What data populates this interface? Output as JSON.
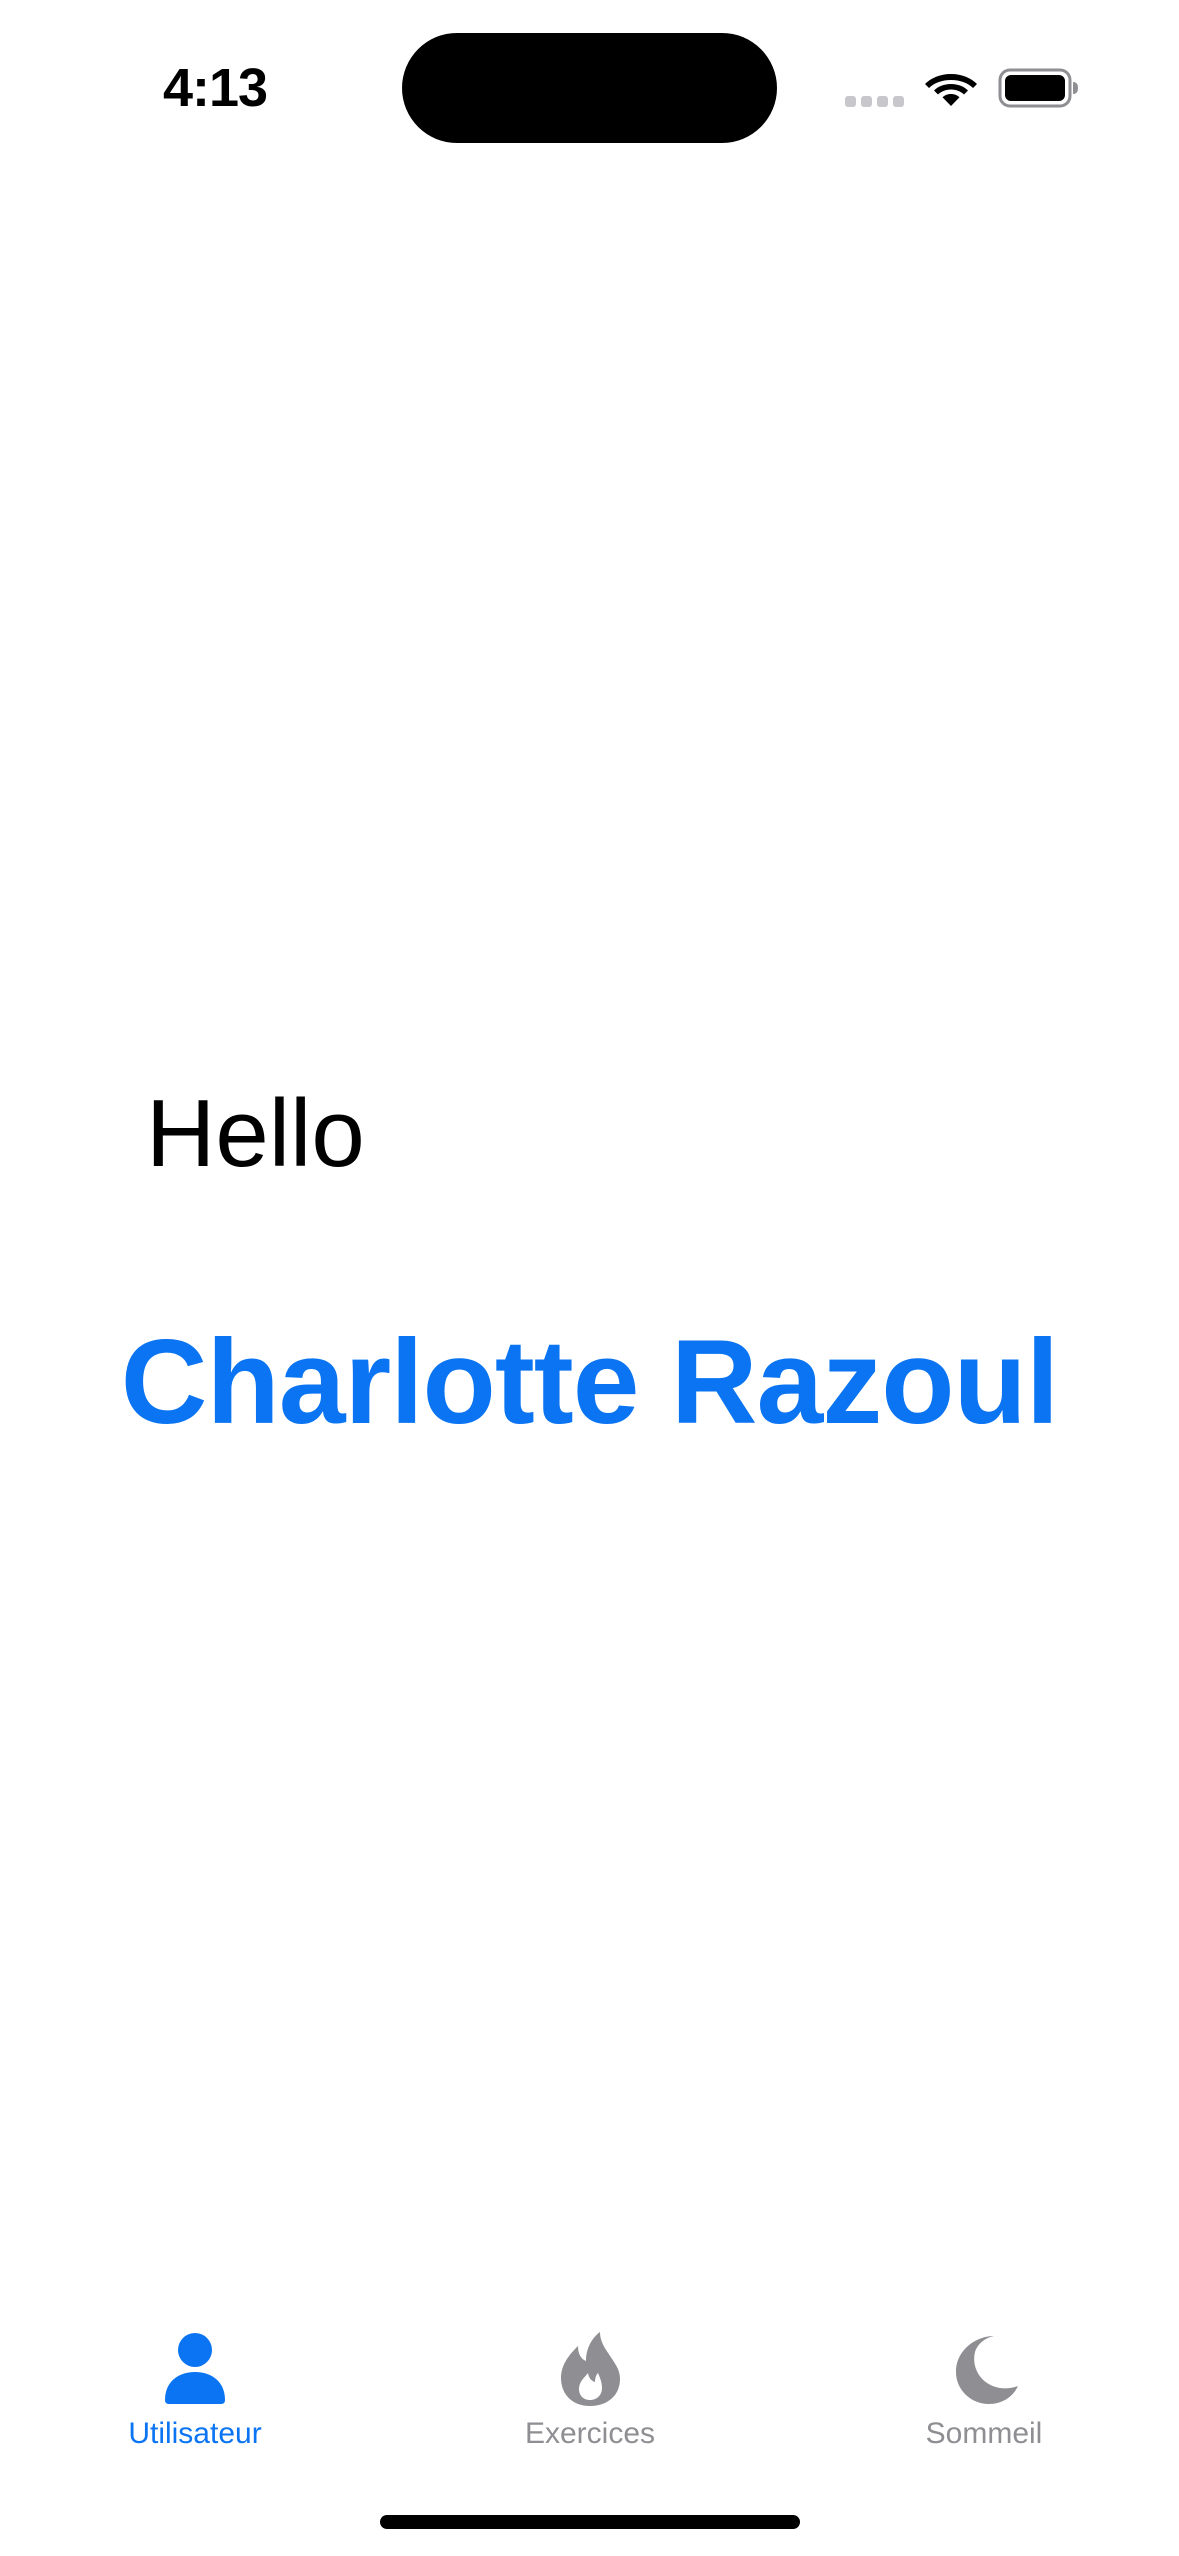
{
  "status_bar": {
    "time": "4:13"
  },
  "main": {
    "greeting": "Hello",
    "user_name": "Charlotte Razoul"
  },
  "tab_bar": {
    "tabs": [
      {
        "label": "Utilisateur",
        "icon": "person-icon",
        "active": true
      },
      {
        "label": "Exercices",
        "icon": "flame-icon",
        "active": false
      },
      {
        "label": "Sommeil",
        "icon": "moon-icon",
        "active": false
      }
    ]
  },
  "colors": {
    "accent": "#0a74f2",
    "inactive": "#8e8e93",
    "background": "#ffffff"
  }
}
